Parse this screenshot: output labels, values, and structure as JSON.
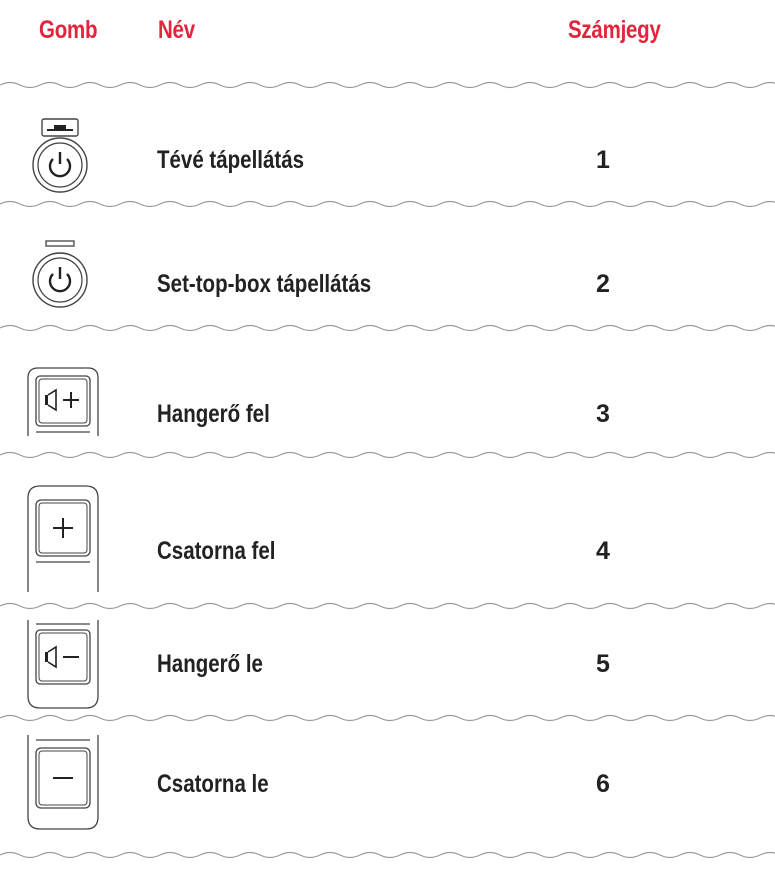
{
  "header": {
    "col_button": "Gomb",
    "col_name": "Név",
    "col_digit": "Számjegy"
  },
  "colors": {
    "header_red": "#e3243b",
    "text_dark": "#222222",
    "line_gray": "#9a9a9a"
  },
  "rows": [
    {
      "icon": "tv-power-icon",
      "name": "Tévé tápellátás",
      "digit": "1"
    },
    {
      "icon": "stb-power-icon",
      "name": "Set-top-box tápellátás",
      "digit": "2"
    },
    {
      "icon": "volume-up-icon",
      "name": "Hangerő fel",
      "digit": "3"
    },
    {
      "icon": "channel-up-icon",
      "name": "Csatorna fel",
      "digit": "4"
    },
    {
      "icon": "volume-down-icon",
      "name": "Hangerő le",
      "digit": "5"
    },
    {
      "icon": "channel-down-icon",
      "name": "Csatorna le",
      "digit": "6"
    }
  ]
}
